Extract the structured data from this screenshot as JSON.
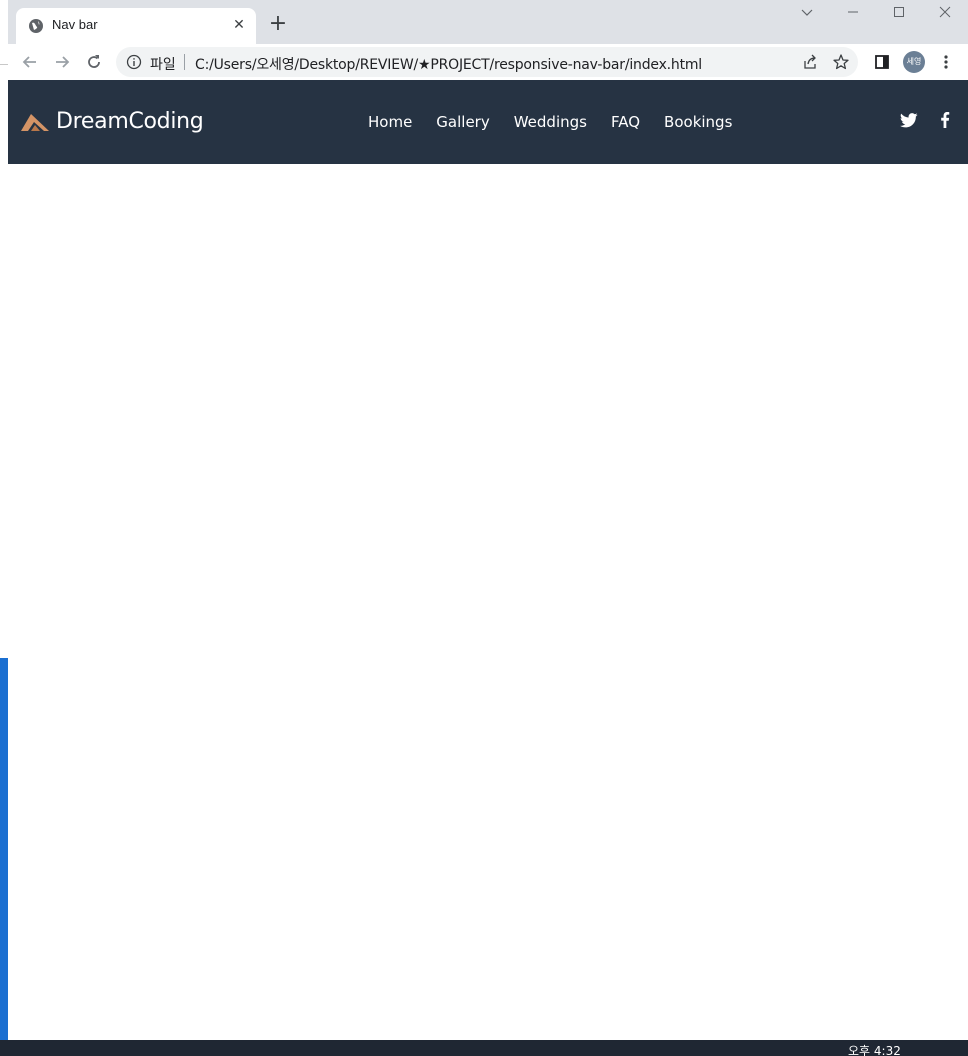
{
  "tab": {
    "title": "Nav bar"
  },
  "toolbar": {
    "scheme_label": "파일",
    "url": "C:/Users/오세영/Desktop/REVIEW/★PROJECT/responsive-nav-bar/index.html",
    "profile": "세영"
  },
  "site": {
    "brand": "DreamCoding",
    "menu": [
      "Home",
      "Gallery",
      "Weddings",
      "FAQ",
      "Bookings"
    ],
    "social": [
      "twitter-icon",
      "facebook-icon"
    ]
  },
  "colors": {
    "nav_background": "#263343",
    "logo_accent": "#d49466",
    "chrome_tabstrip": "#dee1e6"
  },
  "taskbar": {
    "clock": "오후 4:32"
  }
}
